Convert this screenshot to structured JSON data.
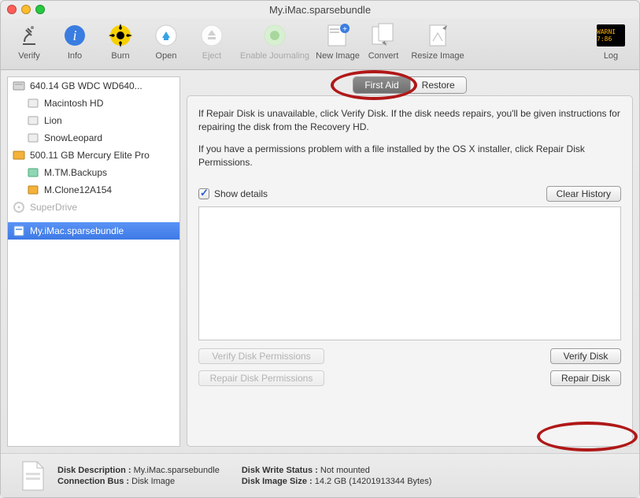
{
  "window": {
    "title": "My.iMac.sparsebundle"
  },
  "toolbar": {
    "items": [
      {
        "label": "Verify"
      },
      {
        "label": "Info"
      },
      {
        "label": "Burn"
      },
      {
        "label": "Open"
      },
      {
        "label": "Eject",
        "disabled": true
      },
      {
        "label": "Enable Journaling",
        "disabled": true
      },
      {
        "label": "New Image"
      },
      {
        "label": "Convert"
      },
      {
        "label": "Resize Image"
      }
    ],
    "log_label": "Log",
    "log_badge": "WARNI\n7:86"
  },
  "sidebar": {
    "items": [
      {
        "label": "640.14 GB WDC WD640...",
        "icon": "hdd"
      },
      {
        "label": "Macintosh HD",
        "icon": "vol",
        "indent": true
      },
      {
        "label": "Lion",
        "icon": "vol",
        "indent": true
      },
      {
        "label": "SnowLeopard",
        "icon": "vol",
        "indent": true
      },
      {
        "label": "500.11 GB Mercury Elite Pro",
        "icon": "ext"
      },
      {
        "label": "M.TM.Backups",
        "icon": "vol-green",
        "indent": true
      },
      {
        "label": "M.Clone12A154",
        "icon": "vol-orange",
        "indent": true
      },
      {
        "label": "SuperDrive",
        "icon": "optical",
        "disabled": true
      },
      {
        "label": "",
        "icon": "blank",
        "blank": true
      },
      {
        "label": "My.iMac.sparsebundle",
        "icon": "dmg",
        "selected": true
      }
    ]
  },
  "tabs": {
    "first_aid": "First Aid",
    "restore": "Restore"
  },
  "pane": {
    "p1": "If Repair Disk is unavailable, click Verify Disk. If the disk needs repairs, you'll be given instructions for repairing the disk from the Recovery HD.",
    "p2": "If you have a permissions problem with a file installed by the OS X installer, click Repair Disk Permissions.",
    "show_details": "Show details",
    "clear_history": "Clear History",
    "verify_perm": "Verify Disk Permissions",
    "repair_perm": "Repair Disk Permissions",
    "verify_disk": "Verify Disk",
    "repair_disk": "Repair Disk"
  },
  "footer": {
    "k_desc": "Disk Description :",
    "v_desc": "My.iMac.sparsebundle",
    "k_conn": "Connection Bus :",
    "v_conn": "Disk Image",
    "k_write": "Disk Write Status :",
    "v_write": "Not mounted",
    "k_size": "Disk Image Size :",
    "v_size": "14.2 GB (14201913344 Bytes)"
  }
}
